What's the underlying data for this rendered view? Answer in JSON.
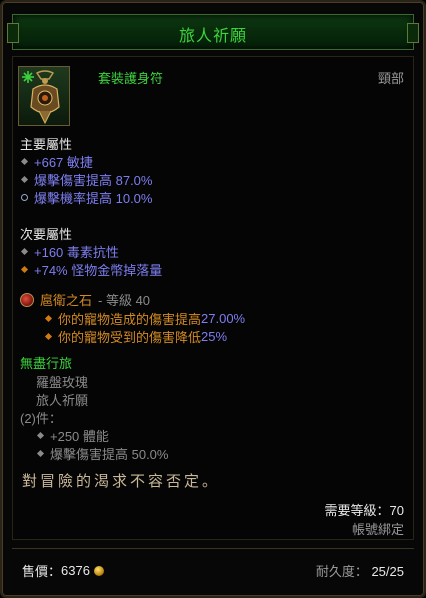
{
  "tooltip": {
    "title": "旅人祈願",
    "item_type": "套裝護身符",
    "slot": "頸部",
    "primary_header": "主要屬性",
    "primary": [
      {
        "text": "+667 敏捷",
        "bullet": "diamond"
      },
      {
        "text": "爆擊傷害提高 87.0%",
        "bullet": "diamond"
      },
      {
        "text": "爆擊機率提高 10.0%",
        "bullet": "ring"
      }
    ],
    "secondary_header": "次要屬性",
    "secondary": [
      {
        "text": "+160 毒素抗性",
        "bullet": "diamond-grey"
      },
      {
        "text": "+74% 怪物金幣掉落量",
        "bullet": "diamond-orange"
      }
    ],
    "gem": {
      "name": "扈衛之石",
      "level_text": "- 等級 40",
      "effects": [
        {
          "prefix": "你的寵物造成的傷害提高 ",
          "value": "27.00%"
        },
        {
          "prefix": "你的寵物受到的傷害降低 ",
          "value": "25%"
        }
      ]
    },
    "set": {
      "name": "無盡行旅",
      "pieces": [
        "羅盤玫瑰",
        "旅人祈願"
      ],
      "bonus_header": "(2)件：",
      "bonuses": [
        "+250 體能",
        "爆擊傷害提高 50.0%"
      ]
    },
    "flavor": "對冒險的渴求不容否定。",
    "required_level": "需要等級：70",
    "binding": "帳號綁定",
    "sell_label": "售價：",
    "sell_value": "6376",
    "durability_label": "耐久度：",
    "durability_value": "25/25"
  },
  "colors": {
    "title_green": "#3cd23c",
    "affix_blue": "#7e7ef0",
    "gem_orange": "#d48a24",
    "set_green": "#3cd23c"
  },
  "icons": {
    "item": "amulet-icon",
    "gem": "gem-icon",
    "currency": "gold-coin-icon"
  }
}
